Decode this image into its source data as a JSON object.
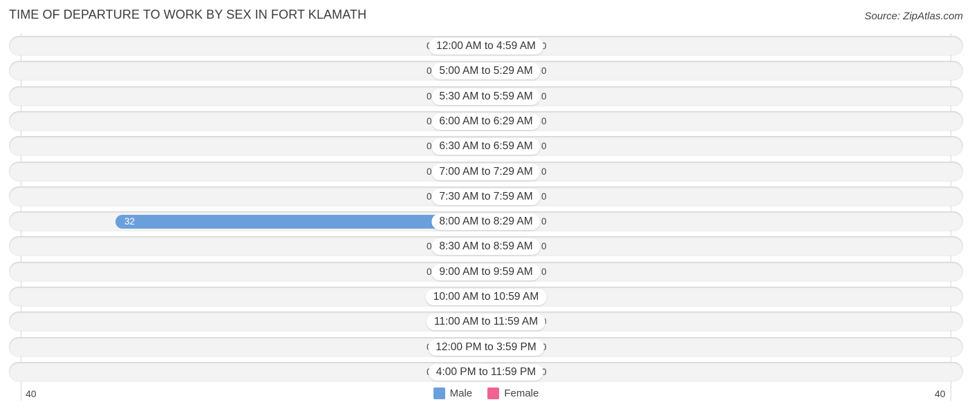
{
  "chart_data": {
    "type": "bar",
    "orientation": "horizontal-diverging",
    "title": "TIME OF DEPARTURE TO WORK BY SEX IN FORT KLAMATH",
    "source": "Source: ZipAtlas.com",
    "categories": [
      "12:00 AM to 4:59 AM",
      "5:00 AM to 5:29 AM",
      "5:30 AM to 5:59 AM",
      "6:00 AM to 6:29 AM",
      "6:30 AM to 6:59 AM",
      "7:00 AM to 7:29 AM",
      "7:30 AM to 7:59 AM",
      "8:00 AM to 8:29 AM",
      "8:30 AM to 8:59 AM",
      "9:00 AM to 9:59 AM",
      "10:00 AM to 10:59 AM",
      "11:00 AM to 11:59 AM",
      "12:00 PM to 3:59 PM",
      "4:00 PM to 11:59 PM"
    ],
    "series": [
      {
        "name": "Male",
        "color": "#6a9fdb",
        "light_color": "#a9c7eb",
        "values": [
          0,
          0,
          0,
          0,
          0,
          0,
          0,
          32,
          0,
          0,
          0,
          0,
          0,
          0
        ]
      },
      {
        "name": "Female",
        "color": "#f06292",
        "light_color": "#f5a8c0",
        "values": [
          0,
          0,
          0,
          0,
          0,
          0,
          0,
          0,
          0,
          0,
          0,
          0,
          0,
          0
        ]
      }
    ],
    "axis": {
      "left_tick": "40",
      "right_tick": "40",
      "range": [
        -40,
        40
      ]
    },
    "legend": {
      "position": "bottom-center",
      "entries": [
        "Male",
        "Female"
      ]
    },
    "grid": false
  }
}
